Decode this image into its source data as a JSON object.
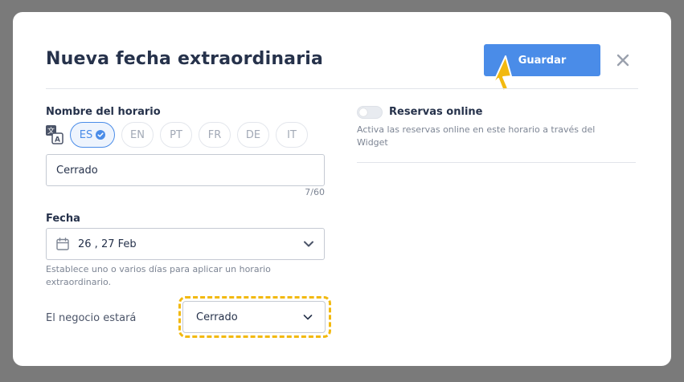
{
  "modal": {
    "title": "Nueva fecha extraordinaria",
    "save_label": "Guardar",
    "close_icon": "close-icon"
  },
  "schedule_name": {
    "label": "Nombre del horario",
    "languages": [
      {
        "code": "ES",
        "active": true
      },
      {
        "code": "EN",
        "active": false
      },
      {
        "code": "PT",
        "active": false
      },
      {
        "code": "FR",
        "active": false
      },
      {
        "code": "DE",
        "active": false
      },
      {
        "code": "IT",
        "active": false
      }
    ],
    "value": "Cerrado",
    "counter": "7/60"
  },
  "date": {
    "label": "Fecha",
    "value": "26 , 27 Feb",
    "help": "Establece uno o varios días para aplicar un horario extraordinario."
  },
  "business_status": {
    "label": "El negocio estará",
    "value": "Cerrado"
  },
  "online_reservations": {
    "label": "Reservas online",
    "enabled": false,
    "help": "Activa las reservas online en este horario a través del Widget"
  },
  "colors": {
    "primary": "#4a8ce8",
    "title": "#26324b",
    "highlight": "#f2b90f",
    "overlay": "#7a7a7a"
  }
}
